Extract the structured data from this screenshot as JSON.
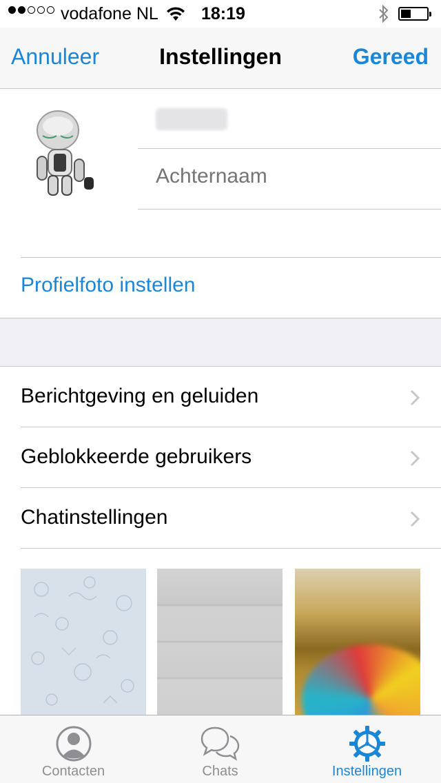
{
  "status_bar": {
    "carrier": "vodafone NL",
    "time": "18:19",
    "signal_bars_filled": 2,
    "signal_bars_total": 5
  },
  "nav_bar": {
    "cancel_label": "Annuleer",
    "title": "Instellingen",
    "done_label": "Gereed"
  },
  "profile": {
    "last_name_placeholder": "Achternaam",
    "set_photo_label": "Profielfoto instellen"
  },
  "settings": {
    "items": [
      {
        "label": "Berichtgeving en geluiden"
      },
      {
        "label": "Geblokkeerde gebruikers"
      },
      {
        "label": "Chatinstellingen"
      }
    ]
  },
  "tab_bar": {
    "tabs": [
      {
        "label": "Contacten",
        "icon": "contacts-icon"
      },
      {
        "label": "Chats",
        "icon": "chats-icon"
      },
      {
        "label": "Instellingen",
        "icon": "settings-icon",
        "active": true
      }
    ]
  },
  "colors": {
    "accent": "#1c86d6",
    "separator": "#c8c7cc",
    "group_background": "#efeff4"
  }
}
